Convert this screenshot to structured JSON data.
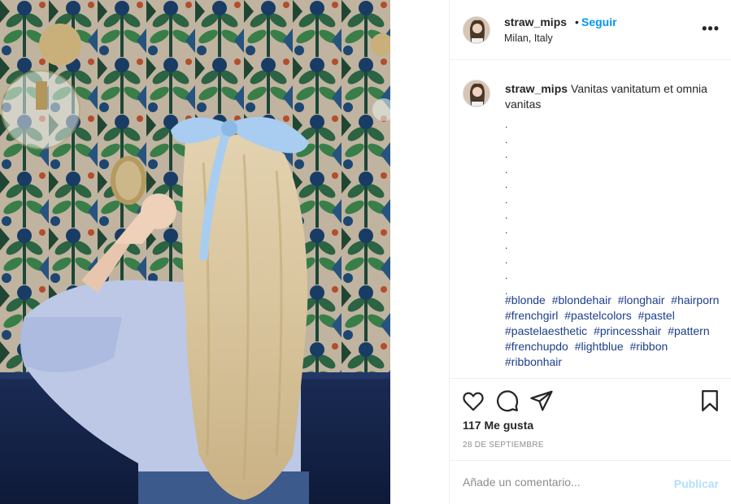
{
  "post": {
    "username": "straw_mips",
    "follow_label": "Seguir",
    "separator": "•",
    "location": "Milan, Italy",
    "more_label": "•••",
    "caption_text": "Vanitas vanitatum et omnia vanitas",
    "dots": [
      ".",
      ".",
      ".",
      ".",
      ".",
      ".",
      ".",
      ".",
      ".",
      ".",
      ".",
      "."
    ],
    "hashtags": [
      "#blonde",
      "#blondehair",
      "#longhair",
      "#hairporn",
      "#frenchgirl",
      "#pastelcolors",
      "#pastel",
      "#pastelaesthetic",
      "#princesshair",
      "#pattern",
      "#frenchupdo",
      "#lightblue",
      "#ribbon",
      "#ribbonhair"
    ],
    "likes": "117 Me gusta",
    "date": "28 DE SEPTIEMBRE",
    "comment_placeholder": "Añade un comentario...",
    "publish_label": "Publicar"
  },
  "icons": {
    "like": "heart-icon",
    "comment": "comment-icon",
    "share": "paper-plane-icon",
    "save": "bookmark-icon"
  },
  "colors": {
    "follow": "#0095f6",
    "hashtag": "#1c3e8a",
    "publish_disabled": "#b2dffc",
    "secondary_text": "#8e8e8e"
  }
}
